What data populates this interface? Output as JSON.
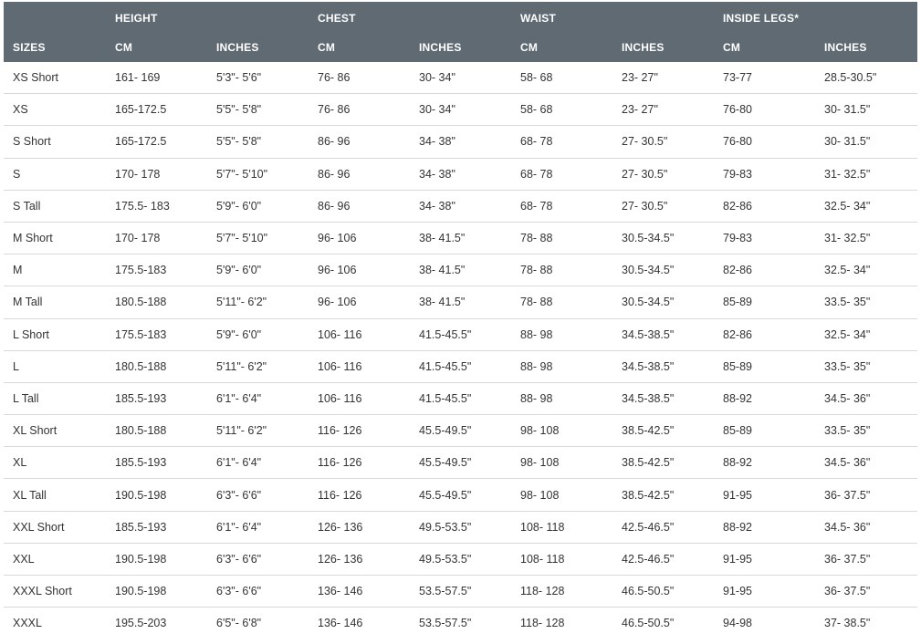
{
  "table": {
    "group_headers": [
      "",
      "HEIGHT",
      "",
      "CHEST",
      "",
      "WAIST",
      "",
      "INSIDE LEGS*",
      ""
    ],
    "unit_headers": [
      "SIZES",
      "CM",
      "INCHES",
      "CM",
      "INCHES",
      "CM",
      "INCHES",
      "CM",
      "INCHES"
    ],
    "rows": [
      [
        "XS Short",
        "161- 169",
        "5'3\"- 5'6\"",
        "76- 86",
        "30- 34\"",
        "58- 68",
        "23- 27\"",
        "73-77",
        "28.5-30.5\""
      ],
      [
        "XS",
        "165-172.5",
        "5'5\"- 5'8\"",
        "76- 86",
        "30- 34\"",
        "58- 68",
        "23- 27\"",
        "76-80",
        "30- 31.5\""
      ],
      [
        "S Short",
        "165-172.5",
        "5'5\"- 5'8\"",
        "86- 96",
        "34- 38\"",
        "68- 78",
        "27- 30.5\"",
        "76-80",
        "30- 31.5\""
      ],
      [
        "S",
        "170- 178",
        "5'7\"- 5'10\"",
        "86- 96",
        "34- 38\"",
        "68- 78",
        "27- 30.5\"",
        "79-83",
        "31- 32.5\""
      ],
      [
        "S Tall",
        "175.5- 183",
        "5'9\"- 6'0\"",
        "86- 96",
        "34- 38\"",
        "68- 78",
        "27- 30.5\"",
        "82-86",
        "32.5- 34\""
      ],
      [
        "M Short",
        "170- 178",
        "5'7\"- 5'10\"",
        "96- 106",
        "38- 41.5\"",
        "78- 88",
        "30.5-34.5\"",
        "79-83",
        "31- 32.5\""
      ],
      [
        "M",
        "175.5-183",
        "5'9\"- 6'0\"",
        "96- 106",
        "38- 41.5\"",
        "78- 88",
        "30.5-34.5\"",
        "82-86",
        "32.5- 34\""
      ],
      [
        "M Tall",
        "180.5-188",
        "5'11\"- 6'2\"",
        "96- 106",
        "38- 41.5\"",
        "78- 88",
        "30.5-34.5\"",
        "85-89",
        "33.5- 35\""
      ],
      [
        "L Short",
        "175.5-183",
        "5'9\"- 6'0\"",
        "106- 116",
        "41.5-45.5\"",
        "88- 98",
        "34.5-38.5\"",
        "82-86",
        "32.5- 34\""
      ],
      [
        "L",
        "180.5-188",
        "5'11\"- 6'2\"",
        "106- 116",
        "41.5-45.5\"",
        "88- 98",
        "34.5-38.5\"",
        "85-89",
        "33.5- 35\""
      ],
      [
        "L Tall",
        "185.5-193",
        "6'1\"- 6'4\"",
        "106- 116",
        "41.5-45.5\"",
        "88- 98",
        "34.5-38.5\"",
        "88-92",
        "34.5- 36\""
      ],
      [
        "XL Short",
        "180.5-188",
        "5'11\"- 6'2\"",
        "116- 126",
        "45.5-49.5\"",
        "98- 108",
        "38.5-42.5\"",
        "85-89",
        "33.5- 35\""
      ],
      [
        "XL",
        "185.5-193",
        "6'1\"- 6'4\"",
        "116- 126",
        "45.5-49.5\"",
        "98- 108",
        "38.5-42.5\"",
        "88-92",
        "34.5- 36\""
      ],
      [
        "XL Tall",
        "190.5-198",
        "6'3\"- 6'6\"",
        "116- 126",
        "45.5-49.5\"",
        "98- 108",
        "38.5-42.5\"",
        "91-95",
        "36- 37.5\""
      ],
      [
        "XXL Short",
        "185.5-193",
        "6'1\"- 6'4\"",
        "126- 136",
        "49.5-53.5\"",
        "108- 118",
        "42.5-46.5\"",
        "88-92",
        "34.5- 36\""
      ],
      [
        "XXL",
        "190.5-198",
        "6'3\"- 6'6\"",
        "126- 136",
        "49.5-53.5\"",
        "108- 118",
        "42.5-46.5\"",
        "91-95",
        "36- 37.5\""
      ],
      [
        "XXXL Short",
        "190.5-198",
        "6'3\"- 6'6\"",
        "136- 146",
        "53.5-57.5\"",
        "118- 128",
        "46.5-50.5\"",
        "91-95",
        "36- 37.5\""
      ],
      [
        "XXXL",
        "195.5-203",
        "6'5\"- 6'8\"",
        "136- 146",
        "53.5-57.5\"",
        "118- 128",
        "46.5-50.5\"",
        "94-98",
        "37- 38.5\""
      ]
    ]
  },
  "colors": {
    "header_background": "#5f6a73",
    "header_text": "#ffffff",
    "body_text": "#333333",
    "row_divider": "#d9d9d9"
  }
}
